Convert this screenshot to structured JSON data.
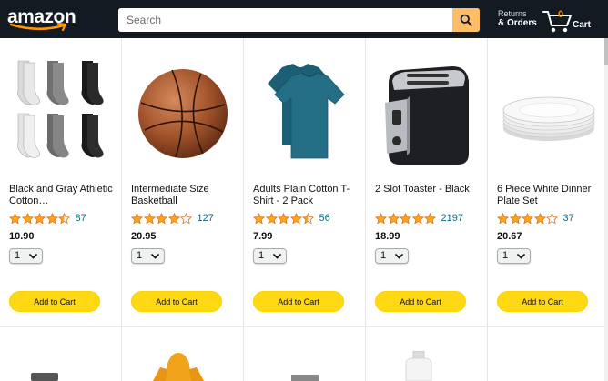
{
  "header": {
    "logo": "amazon",
    "search_placeholder": "Search",
    "returns_line1": "Returns",
    "returns_line2": "& Orders",
    "cart_count": "0",
    "cart_label": "Cart"
  },
  "colors": {
    "header_bg": "#131a22",
    "search_button": "#febd69",
    "star": "#ffa41c",
    "add_to_cart": "#ffd814",
    "rating_link": "#007185"
  },
  "products": [
    {
      "title": "Black and Gray Athletic Cotton…",
      "stars": 4.5,
      "reviews": "87",
      "price": "10.90",
      "qty": "1",
      "button": "Add to Cart",
      "image": "socks"
    },
    {
      "title": "Intermediate Size Basketball",
      "stars": 4.0,
      "reviews": "127",
      "price": "20.95",
      "qty": "1",
      "button": "Add to Cart",
      "image": "basketball"
    },
    {
      "title": "Adults Plain Cotton T-Shirt - 2 Pack",
      "stars": 4.5,
      "reviews": "56",
      "price": "7.99",
      "qty": "1",
      "button": "Add to Cart",
      "image": "tshirt"
    },
    {
      "title": "2 Slot Toaster - Black",
      "stars": 5.0,
      "reviews": "2197",
      "price": "18.99",
      "qty": "1",
      "button": "Add to Cart",
      "image": "toaster"
    },
    {
      "title": "6 Piece White Dinner Plate Set",
      "stars": 4.0,
      "reviews": "37",
      "price": "20.67",
      "qty": "1",
      "button": "Add to Cart",
      "image": "plates"
    }
  ]
}
